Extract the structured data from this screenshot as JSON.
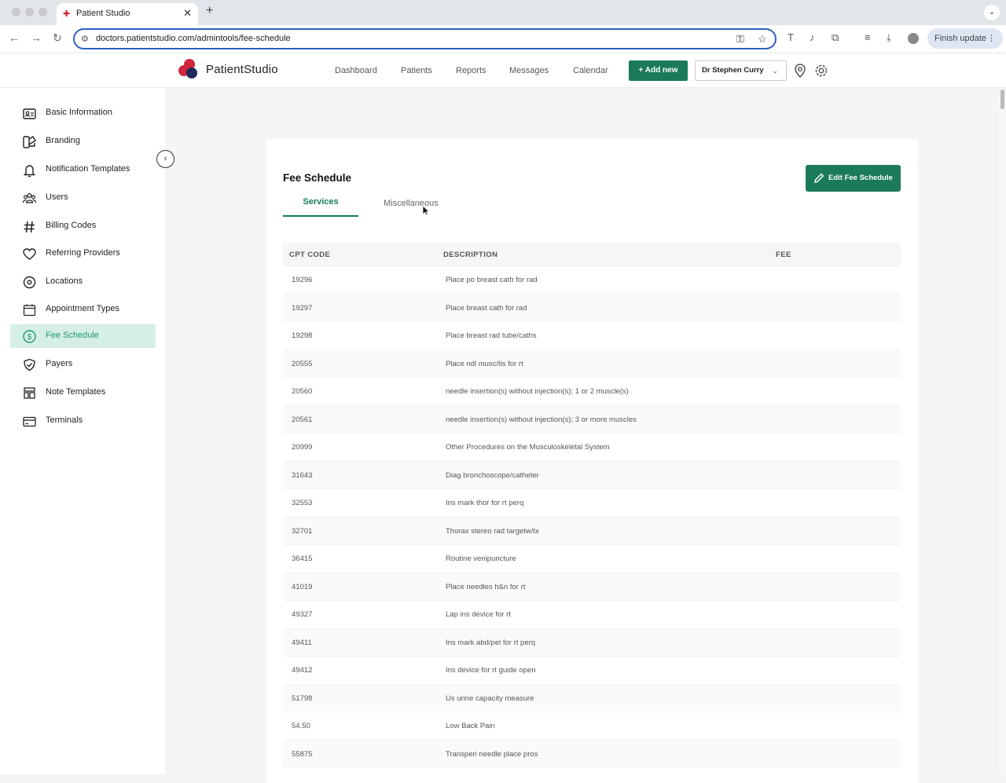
{
  "browser": {
    "tab_title": "Patient Studio",
    "url": "doctors.patientstudio.com/admintools/fee-schedule",
    "finish_update": "Finish update"
  },
  "header": {
    "logo_text": "PatientStudio",
    "nav": [
      "Dashboard",
      "Patients",
      "Reports",
      "Messages",
      "Calendar"
    ],
    "add_new": "Add new",
    "user": "Dr Stephen Curry",
    "brand_color": "#1a7a5a"
  },
  "sidebar": {
    "items": [
      {
        "label": "Basic Information",
        "icon": "id-card-icon"
      },
      {
        "label": "Branding",
        "icon": "palette-icon"
      },
      {
        "label": "Notification Templates",
        "icon": "bell-icon"
      },
      {
        "label": "Users",
        "icon": "users-icon"
      },
      {
        "label": "Billing Codes",
        "icon": "hash-icon"
      },
      {
        "label": "Referring Providers",
        "icon": "heart-icon"
      },
      {
        "label": "Locations",
        "icon": "location-pin-icon"
      },
      {
        "label": "Appointment Types",
        "icon": "calendar-icon"
      },
      {
        "label": "Fee Schedule",
        "icon": "dollar-icon",
        "active": true
      },
      {
        "label": "Payers",
        "icon": "shield-check-icon"
      },
      {
        "label": "Note Templates",
        "icon": "template-icon"
      },
      {
        "label": "Terminals",
        "icon": "card-terminal-icon"
      }
    ]
  },
  "main": {
    "title": "Fee Schedule",
    "edit_button": "Edit Fee Schedule",
    "tabs": [
      "Services",
      "Miscellaneous"
    ],
    "columns": [
      "CPT CODE",
      "DESCRIPTION",
      "FEE"
    ],
    "rows": [
      {
        "code": "19296",
        "description": "Place po breast cath for rad"
      },
      {
        "code": "19297",
        "description": "Place breast cath for rad"
      },
      {
        "code": "19298",
        "description": "Place breast rad tube/caths"
      },
      {
        "code": "20555",
        "description": "Place ndl musc/tis for rt"
      },
      {
        "code": "20560",
        "description": "needle insertion(s) without injection(s); 1 or 2 muscle(s)"
      },
      {
        "code": "20561",
        "description": "needle insertion(s) without injection(s); 3 or more muscles"
      },
      {
        "code": "20999",
        "description": "Other Procedures on the Musculoskeletal System"
      },
      {
        "code": "31643",
        "description": "Diag bronchoscope/catheter"
      },
      {
        "code": "32553",
        "description": "Ins mark thor for rt perq"
      },
      {
        "code": "32701",
        "description": "Thorax stereo rad targetw/tx"
      },
      {
        "code": "36415",
        "description": "Routine venipuncture"
      },
      {
        "code": "41019",
        "description": "Place needles h&n for rt"
      },
      {
        "code": "49327",
        "description": "Lap ins device for rt"
      },
      {
        "code": "49411",
        "description": "Ins mark abd/pel for rt perq"
      },
      {
        "code": "49412",
        "description": "Ins device for rt guide open"
      },
      {
        "code": "51798",
        "description": "Us urine capacity measure"
      },
      {
        "code": "54.50",
        "description": "Low Back Pain"
      },
      {
        "code": "55875",
        "description": "Transperi needle place pros"
      }
    ]
  }
}
